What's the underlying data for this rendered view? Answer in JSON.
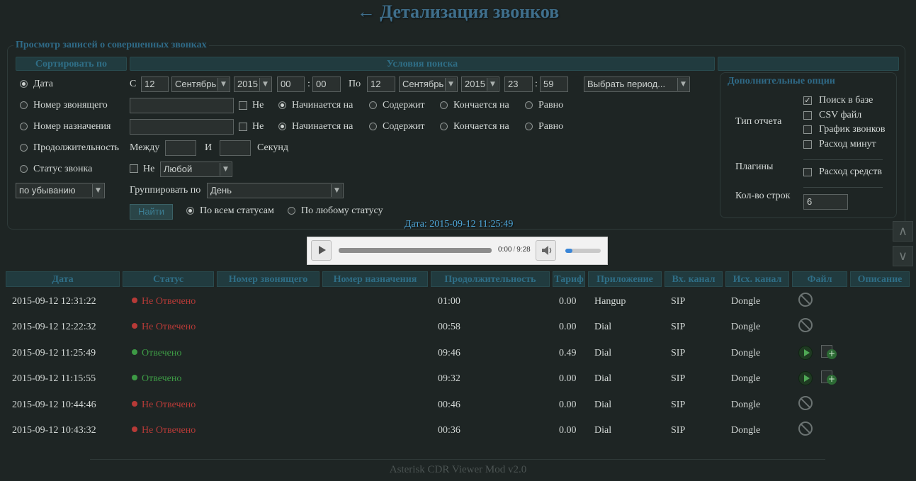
{
  "page": {
    "title": "← Детализация звонков",
    "footer": "Asterisk CDR Viewer Mod v2.0"
  },
  "form": {
    "legend": "Просмотр записей о совершенных звонках",
    "sort_header": "Сортировать по",
    "search_header": "Условия поиска",
    "sort_options": {
      "date": "Дата",
      "caller": "Номер звонящего",
      "dest": "Номер назначения",
      "duration": "Продолжительность",
      "status": "Статус звонка"
    },
    "from_label": "С",
    "to_label": "По",
    "date_from": {
      "day": "12",
      "month": "Сентябрь",
      "year": "2015",
      "hour": "00",
      "minute": "00"
    },
    "date_to": {
      "day": "12",
      "month": "Сентябрь",
      "year": "2015",
      "hour": "23",
      "minute": "59"
    },
    "time_sep": ":",
    "period_select": "Выбрать период...",
    "not_label": "Не",
    "match_options": {
      "starts": "Начинается на",
      "contains": "Содержит",
      "ends": "Кончается на",
      "equals": "Равно"
    },
    "between_label": "Между",
    "and_label": "И",
    "seconds_label": "Секунд",
    "status_select": "Любой",
    "order_select": "по убыванию",
    "group_label": "Группировать по",
    "group_select": "День",
    "search_button": "Найти",
    "all_statuses": "По всем статусам",
    "any_status": "По любому статусу"
  },
  "extra": {
    "legend": "Дополнительные опции",
    "report_type_label": "Тип отчета",
    "report_types": [
      "Поиск в базе",
      "CSV файл",
      "График звонков",
      "Расход минут"
    ],
    "plugins_label": "Плагины",
    "plugin": "Расход средств",
    "rows_label": "Кол-во строк",
    "rows_value": "6"
  },
  "player": {
    "caption": "Дата: 2015-09-12 11:25:49",
    "current": "0:00",
    "sep": "/",
    "total": "9:28",
    "progress": 0.0,
    "volume": 0.2
  },
  "nav": {
    "up": "∧",
    "down": "∨"
  },
  "table": {
    "headers": [
      "Дата",
      "Статус",
      "Номер звонящего",
      "Номер назначения",
      "Продолжительность",
      "Тариф",
      "Приложение",
      "Вх. канал",
      "Исх. канал",
      "Файл",
      "Описание"
    ],
    "rows": [
      {
        "date": "2015-09-12 12:31:22",
        "status": "Не Отвечено",
        "answered": false,
        "caller": "",
        "dest": "",
        "duration": "01:00",
        "tariff": "0.00",
        "app": "Hangup",
        "in": "SIP",
        "out": "Dongle",
        "file": "no-file-icon",
        "desc": ""
      },
      {
        "date": "2015-09-12 12:22:32",
        "status": "Не Отвечено",
        "answered": false,
        "caller": "",
        "dest": "",
        "duration": "00:58",
        "tariff": "0.00",
        "app": "Dial",
        "in": "SIP",
        "out": "Dongle",
        "file": "no-file-icon",
        "desc": ""
      },
      {
        "date": "2015-09-12 11:25:49",
        "status": "Отвечено",
        "answered": true,
        "caller": "",
        "dest": "",
        "duration": "09:46",
        "tariff": "0.49",
        "app": "Dial",
        "in": "SIP",
        "out": "Dongle",
        "file": "play-icon",
        "desc": ""
      },
      {
        "date": "2015-09-12 11:15:55",
        "status": "Отвечено",
        "answered": true,
        "caller": "",
        "dest": "",
        "duration": "09:32",
        "tariff": "0.00",
        "app": "Dial",
        "in": "SIP",
        "out": "Dongle",
        "file": "play-icon",
        "desc": ""
      },
      {
        "date": "2015-09-12 10:44:46",
        "status": "Не Отвечено",
        "answered": false,
        "caller": "",
        "dest": "",
        "duration": "00:46",
        "tariff": "0.00",
        "app": "Dial",
        "in": "SIP",
        "out": "Dongle",
        "file": "no-file-icon",
        "desc": ""
      },
      {
        "date": "2015-09-12 10:43:32",
        "status": "Не Отвечено",
        "answered": false,
        "caller": "",
        "dest": "",
        "duration": "00:36",
        "tariff": "0.00",
        "app": "Dial",
        "in": "SIP",
        "out": "Dongle",
        "file": "no-file-icon",
        "desc": ""
      }
    ]
  },
  "colors": {
    "answered": "#3d9a45",
    "not_answered": "#b73a37",
    "header_text": "#2f6e86"
  }
}
